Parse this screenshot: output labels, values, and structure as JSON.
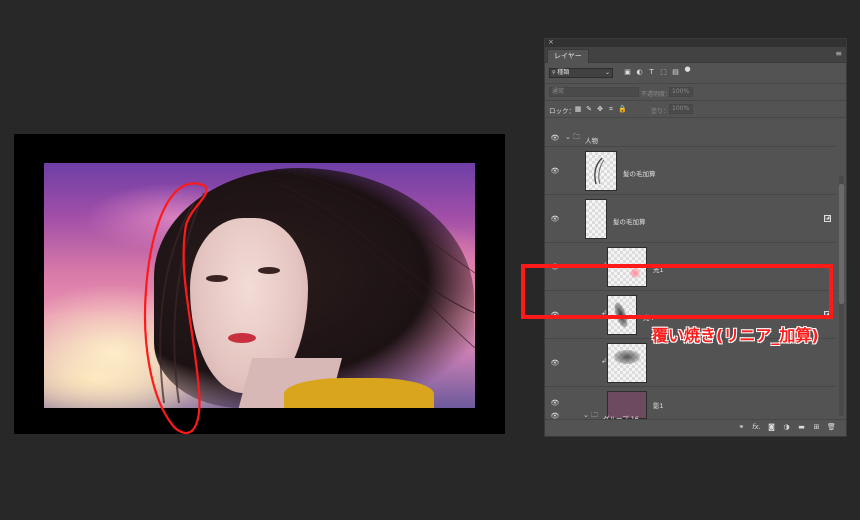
{
  "canvas": {
    "description_icon": "photo-canvas"
  },
  "panel": {
    "close_glyph": "×",
    "tab_label": "レイヤー",
    "menu_glyph": "≡",
    "filter": {
      "select_label": "種類",
      "search_glyph": "🔍",
      "icons": [
        "image-filter-icon",
        "adjustment-filter-icon",
        "type-filter-icon",
        "shape-filter-icon",
        "smart-object-filter-icon",
        "filter-toggle-icon"
      ]
    },
    "blend": {
      "mode": "通常",
      "opacity_label": "不透明度：",
      "opacity_value": "100%"
    },
    "lock": {
      "label": "ロック：",
      "fill_label": "塗り：",
      "fill_value": "100%"
    },
    "layers": [
      {
        "name": "人物",
        "type": "group",
        "expanded": true
      },
      {
        "name": "髪の毛加算",
        "type": "layer"
      },
      {
        "name": "髪の毛加算",
        "type": "layer",
        "smart": true
      },
      {
        "name": "光1",
        "type": "clip"
      },
      {
        "name": "光4",
        "type": "clip",
        "smart": true,
        "highlighted": true
      },
      {
        "name": "",
        "type": "clip"
      },
      {
        "name": "影1",
        "type": "layer"
      },
      {
        "name": "グループ 16",
        "type": "group",
        "expanded": false
      }
    ],
    "bottom_icons": [
      "link-icon",
      "fx-icon",
      "mask-icon",
      "adjustment-icon",
      "folder-icon",
      "new-layer-icon",
      "trash-icon"
    ],
    "bottom_fx": "fx."
  },
  "annotation": {
    "label": "覆い焼き(リニア_加算)",
    "color": "#ff1a1a"
  }
}
